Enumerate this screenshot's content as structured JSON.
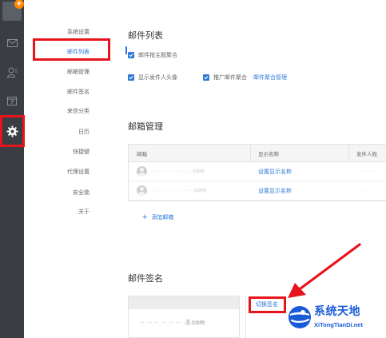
{
  "rail": {
    "icons": [
      "compose-icon",
      "mail-icon",
      "contacts-icon",
      "calendar-icon",
      "settings-icon"
    ],
    "compose_plus": "+"
  },
  "subnav": {
    "items": [
      {
        "label": "系统设置"
      },
      {
        "label": "邮件列表"
      },
      {
        "label": "邮箱管理"
      },
      {
        "label": "邮件签名"
      },
      {
        "label": "来信分类"
      },
      {
        "label": "日历"
      },
      {
        "label": "快捷键"
      },
      {
        "label": "代理设置"
      },
      {
        "label": "安全锁"
      },
      {
        "label": "关于"
      }
    ],
    "active_index": 1
  },
  "mail_list": {
    "title": "邮件列表",
    "options": [
      {
        "label": "邮件按主题聚合",
        "checked": true
      },
      {
        "label": "显示发件人头像",
        "checked": true
      },
      {
        "label": "推广邮件聚合",
        "checked": true
      }
    ],
    "promo_manage_link": "邮件聚合管理"
  },
  "mailbox_mgmt": {
    "title": "邮箱管理",
    "columns": [
      "邮箱",
      "显示名称",
      "发件人姓"
    ],
    "rows": [
      {
        "email": "··· ·· ··· ·· ·· ·.com",
        "action": "设置显示名称",
        "sender": "· · · ·"
      },
      {
        "email": "·. · · ·· ···· ·· ·.com",
        "action": "设置显示名称",
        "sender": "· · ·"
      }
    ],
    "add_label": "添加邮箱",
    "add_symbol": "+"
  },
  "signature": {
    "title": "邮件签名",
    "email": "·· ·· ·· ·· ·· ·· ·3.com",
    "switch_label": "切换签名"
  },
  "watermark": {
    "name": "系统天地",
    "url": "XiTongTianDi.net"
  },
  "colors": {
    "accent": "#2f7ad7",
    "highlight": "#e8141c",
    "rail": "#3a3d42"
  }
}
